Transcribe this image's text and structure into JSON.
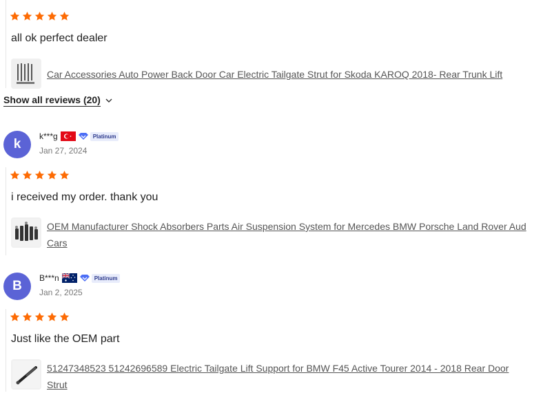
{
  "reviews": [
    {
      "rating": 5,
      "text": "all ok perfect dealer",
      "product_link": "Car Accessories Auto Power Back Door Car Electric Tailgate Strut for Skoda KAROQ 2018- Rear Trunk Lift"
    },
    {
      "user": "k***g",
      "avatar_initial": "k",
      "country_flag": "turkey-flag",
      "badge": "Platinum",
      "date": "Jan 27, 2024",
      "rating": 5,
      "text": "i received my order. thank you",
      "product_link_line1": "OEM Manufacturer Shock Absorbers Parts Air Suspension System for Mercedes BMW Porsche Land Rover Aud",
      "product_link_line2": "Cars"
    },
    {
      "user": "B***n",
      "avatar_initial": "B",
      "country_flag": "australia-flag",
      "badge": "Platinum",
      "date": "Jan 2, 2025",
      "rating": 5,
      "text": "Just like the OEM part",
      "product_link_line1": "51247348523 51242696589 Electric Tailgate Lift Support for BMW F45 Active Tourer 2014 - 2018 Rear Door",
      "product_link_line2": "Strut"
    }
  ],
  "show_all_label": "Show all reviews (20)",
  "colors": {
    "star": "#fd6b04",
    "avatar": "#5b63d6",
    "badge_bg": "#e8ecfb"
  }
}
